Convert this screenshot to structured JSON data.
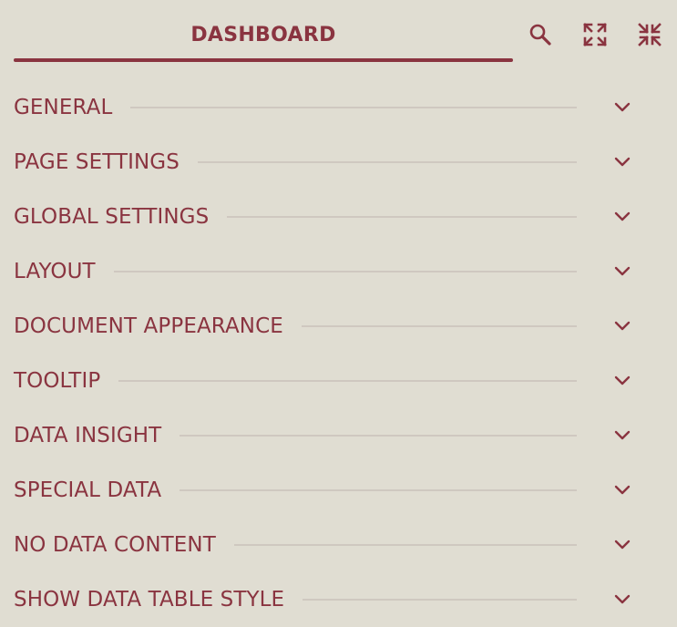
{
  "header": {
    "tab_label": "DASHBOARD",
    "search_icon": "search-icon",
    "expand_icon": "expand-icon",
    "collapse_icon": "collapse-icon"
  },
  "colors": {
    "background": "#e0ddd2",
    "accent": "#8a3440",
    "divider": "#cfc8c0"
  },
  "sections": [
    {
      "label": "GENERAL"
    },
    {
      "label": "PAGE SETTINGS"
    },
    {
      "label": "GLOBAL SETTINGS"
    },
    {
      "label": "LAYOUT"
    },
    {
      "label": "DOCUMENT APPEARANCE"
    },
    {
      "label": "TOOLTIP"
    },
    {
      "label": "DATA INSIGHT"
    },
    {
      "label": "SPECIAL DATA"
    },
    {
      "label": "NO DATA CONTENT"
    },
    {
      "label": "SHOW DATA TABLE STYLE"
    }
  ]
}
